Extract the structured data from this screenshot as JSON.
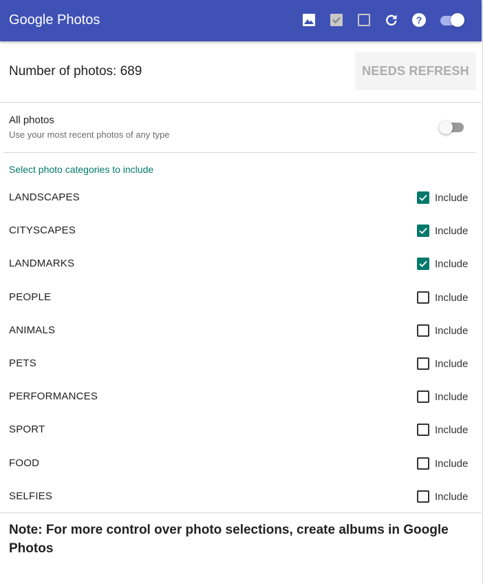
{
  "toolbar": {
    "title": "Google Photos",
    "icons": [
      "image-icon",
      "check-box-icon",
      "check-box-outline-icon",
      "refresh-icon",
      "help-icon"
    ],
    "toggle_on": true
  },
  "summary": {
    "count_text": "Number of photos: 689",
    "refresh_label": "NEEDS REFRESH"
  },
  "all_photos": {
    "title": "All photos",
    "subtitle": "Use your most recent photos of any type",
    "enabled": false
  },
  "categories_heading": "Select photo categories to include",
  "include_label": "Include",
  "categories": [
    {
      "name": "LANDSCAPES",
      "checked": true
    },
    {
      "name": "CITYSCAPES",
      "checked": true
    },
    {
      "name": "LANDMARKS",
      "checked": true
    },
    {
      "name": "PEOPLE",
      "checked": false
    },
    {
      "name": "ANIMALS",
      "checked": false
    },
    {
      "name": "PETS",
      "checked": false
    },
    {
      "name": "PERFORMANCES",
      "checked": false
    },
    {
      "name": "SPORT",
      "checked": false
    },
    {
      "name": "FOOD",
      "checked": false
    },
    {
      "name": "SELFIES",
      "checked": false
    }
  ],
  "note": "Note: For more control over photo selections, create albums in Google Photos",
  "colors": {
    "toolbar": "#3f51b5",
    "accent": "#00796b",
    "toggle_track_on": "#a7b4ee"
  }
}
